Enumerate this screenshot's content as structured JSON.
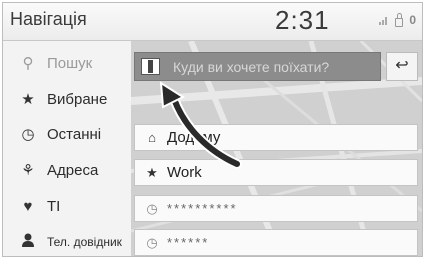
{
  "header": {
    "title": "Навігація",
    "clock": "2:31",
    "status_icons": [
      "signal-icon",
      "lock-icon",
      "alert-icon"
    ],
    "status_text": "0"
  },
  "sidebar": {
    "items": [
      {
        "icon": "search-icon",
        "glyph": "⚲",
        "label": "Пошук"
      },
      {
        "icon": "star-icon",
        "glyph": "★",
        "label": "Вибране"
      },
      {
        "icon": "clock-icon",
        "glyph": "◷",
        "label": "Останні"
      },
      {
        "icon": "address-icon",
        "glyph": "⚘",
        "label": "Адреса"
      },
      {
        "icon": "poi-icon",
        "glyph": "♥",
        "label": "ТІ"
      },
      {
        "icon": "person-icon",
        "glyph": "👤",
        "label": "Тел. довідник"
      }
    ]
  },
  "search": {
    "placeholder": "Куди ви хочете поїхати?",
    "back_glyph": "↩"
  },
  "rows": [
    {
      "icon": "home-icon",
      "glyph": "⌂",
      "text": "Додому"
    },
    {
      "icon": "star-icon",
      "glyph": "★",
      "text": "Work"
    },
    {
      "icon": "clock-icon",
      "glyph": "◷",
      "text": "**********"
    },
    {
      "icon": "clock-icon",
      "glyph": "◷",
      "text": "******"
    }
  ],
  "colors": {
    "background": "#e9e9e9",
    "searchbar": "#8c8c8c",
    "arrow": "#2a2a2a"
  }
}
